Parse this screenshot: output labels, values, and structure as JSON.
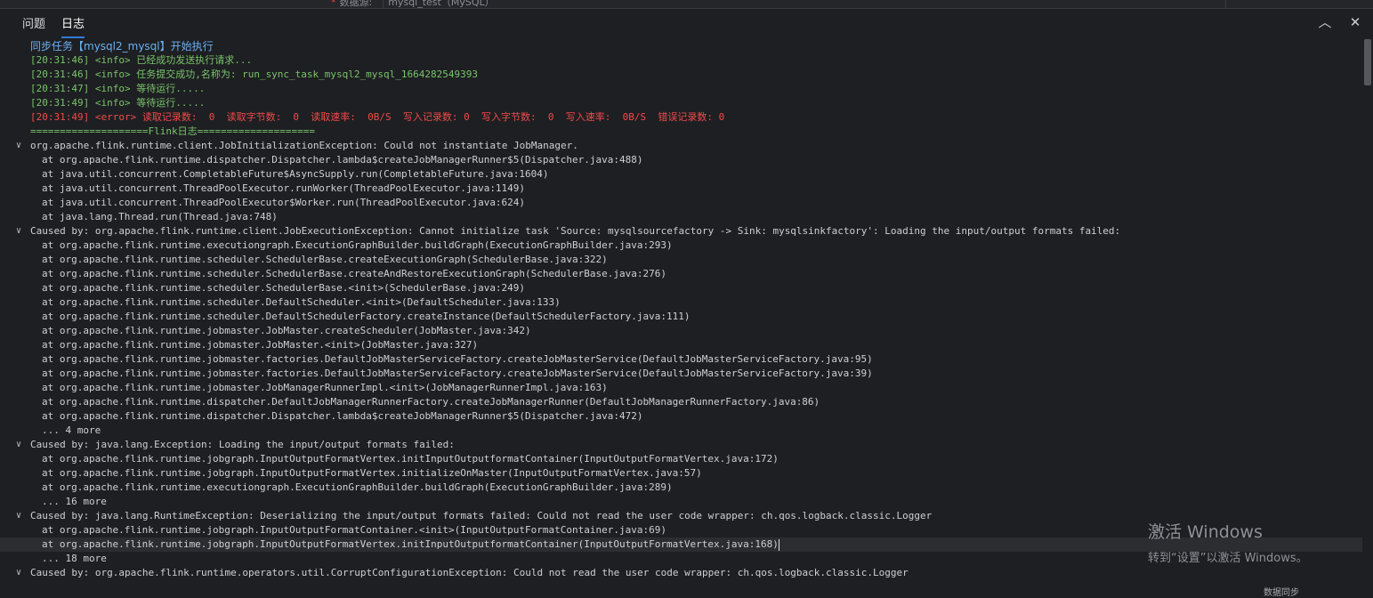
{
  "topbar": {
    "datasource_label": "数据源:",
    "datasource_value": "mysql_test（MySQL）"
  },
  "tabs": [
    {
      "label": "问题",
      "active": false
    },
    {
      "label": "日志",
      "active": true
    }
  ],
  "controls": {
    "collapse": "︿",
    "close": "✕"
  },
  "log": {
    "header": "同步任务【mysql2_mysql】开始执行",
    "info_lines": [
      "[20:31:46] <info> 已经成功发送执行请求...",
      "[20:31:46] <info> 任务提交成功,名称为: run_sync_task_mysql2_mysql_1664282549393",
      "[20:31:47] <info> 等待运行.....",
      "[20:31:49] <info> 等待运行....."
    ],
    "error_line": "[20:31:49] <error> 读取记录数:  0  读取字节数:  0  读取速率:  0B/S  写入记录数: 0  写入字节数:  0  写入速率:  0B/S  错误记录数: 0",
    "separator": "====================Flink日志====================",
    "blocks": [
      {
        "title": "org.apache.flink.runtime.client.JobInitializationException: Could not instantiate JobManager.",
        "frames": [
          "at org.apache.flink.runtime.dispatcher.Dispatcher.lambda$createJobManagerRunner$5(Dispatcher.java:488)",
          "at java.util.concurrent.CompletableFuture$AsyncSupply.run(CompletableFuture.java:1604)",
          "at java.util.concurrent.ThreadPoolExecutor.runWorker(ThreadPoolExecutor.java:1149)",
          "at java.util.concurrent.ThreadPoolExecutor$Worker.run(ThreadPoolExecutor.java:624)",
          "at java.lang.Thread.run(Thread.java:748)"
        ],
        "more": ""
      },
      {
        "title": "Caused by: org.apache.flink.runtime.client.JobExecutionException: Cannot initialize task 'Source: mysqlsourcefactory -> Sink: mysqlsinkfactory': Loading the input/output formats failed:",
        "frames": [
          "at org.apache.flink.runtime.executiongraph.ExecutionGraphBuilder.buildGraph(ExecutionGraphBuilder.java:293)",
          "at org.apache.flink.runtime.scheduler.SchedulerBase.createExecutionGraph(SchedulerBase.java:322)",
          "at org.apache.flink.runtime.scheduler.SchedulerBase.createAndRestoreExecutionGraph(SchedulerBase.java:276)",
          "at org.apache.flink.runtime.scheduler.SchedulerBase.<init>(SchedulerBase.java:249)",
          "at org.apache.flink.runtime.scheduler.DefaultScheduler.<init>(DefaultScheduler.java:133)",
          "at org.apache.flink.runtime.scheduler.DefaultSchedulerFactory.createInstance(DefaultSchedulerFactory.java:111)",
          "at org.apache.flink.runtime.jobmaster.JobMaster.createScheduler(JobMaster.java:342)",
          "at org.apache.flink.runtime.jobmaster.JobMaster.<init>(JobMaster.java:327)",
          "at org.apache.flink.runtime.jobmaster.factories.DefaultJobMasterServiceFactory.createJobMasterService(DefaultJobMasterServiceFactory.java:95)",
          "at org.apache.flink.runtime.jobmaster.factories.DefaultJobMasterServiceFactory.createJobMasterService(DefaultJobMasterServiceFactory.java:39)",
          "at org.apache.flink.runtime.jobmaster.JobManagerRunnerImpl.<init>(JobManagerRunnerImpl.java:163)",
          "at org.apache.flink.runtime.dispatcher.DefaultJobManagerRunnerFactory.createJobManagerRunner(DefaultJobManagerRunnerFactory.java:86)",
          "at org.apache.flink.runtime.dispatcher.Dispatcher.lambda$createJobManagerRunner$5(Dispatcher.java:472)"
        ],
        "more": "... 4 more"
      },
      {
        "title": "Caused by: java.lang.Exception: Loading the input/output formats failed:",
        "frames": [
          "at org.apache.flink.runtime.jobgraph.InputOutputFormatVertex.initInputOutputformatContainer(InputOutputFormatVertex.java:172)",
          "at org.apache.flink.runtime.jobgraph.InputOutputFormatVertex.initializeOnMaster(InputOutputFormatVertex.java:57)",
          "at org.apache.flink.runtime.executiongraph.ExecutionGraphBuilder.buildGraph(ExecutionGraphBuilder.java:289)"
        ],
        "more": "... 16 more"
      },
      {
        "title": "Caused by: java.lang.RuntimeException: Deserializing the input/output formats failed: Could not read the user code wrapper: ch.qos.logback.classic.Logger",
        "frames": [
          "at org.apache.flink.runtime.jobgraph.InputOutputFormatContainer.<init>(InputOutputFormatContainer.java:69)",
          "at org.apache.flink.runtime.jobgraph.InputOutputFormatVertex.initInputOutputformatContainer(InputOutputFormatVertex.java:168)"
        ],
        "more": "... 18 more"
      },
      {
        "title": "Caused by: org.apache.flink.runtime.operators.util.CorruptConfigurationException: Could not read the user code wrapper: ch.qos.logback.classic.Logger",
        "frames": [],
        "more": ""
      }
    ]
  },
  "watermark": {
    "title": "激活 Windows",
    "subtitle": "转到“设置”以激活 Windows。"
  },
  "statusbar": {
    "text": "数据同步"
  },
  "colors": {
    "background": "#1e1f22",
    "info": "#79c36c",
    "error": "#ef4a4a",
    "header": "#6ab0f3",
    "accent": "#2f7bd8"
  }
}
